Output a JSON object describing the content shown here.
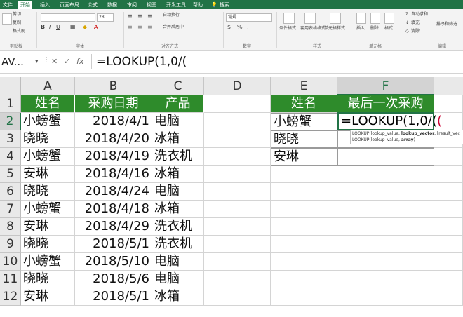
{
  "ribbon_tabs": [
    {
      "label": "文件",
      "active": false
    },
    {
      "label": "开始",
      "active": true
    },
    {
      "label": "插入",
      "active": false
    },
    {
      "label": "页面布局",
      "active": false
    },
    {
      "label": "公式",
      "active": false
    },
    {
      "label": "数据",
      "active": false
    },
    {
      "label": "审阅",
      "active": false
    },
    {
      "label": "视图",
      "active": false
    },
    {
      "label": "开发工具",
      "active": false
    },
    {
      "label": "帮助",
      "active": false
    }
  ],
  "tell_me_label": "搜索",
  "ribbon": {
    "cut": "剪切",
    "copy": "复制",
    "format_painter": "格式刷",
    "clipboard_group": "剪贴板",
    "font_name": "",
    "font_size": "28",
    "font_group": "字体",
    "wrap_text": "自动换行",
    "merge_center": "合并后居中",
    "alignment_group": "对齐方式",
    "number_format": "常规",
    "number_group": "数字",
    "conditional_format": "条件格式",
    "format_table": "套用表格格式",
    "cell_styles": "单元格样式",
    "styles_group": "样式",
    "insert": "插入",
    "delete": "删除",
    "format": "格式",
    "cells_group": "单元格",
    "autosum": "自动求和",
    "fill": "填充",
    "clear": "清除",
    "sort_filter": "排序和筛选",
    "editing_group": "编辑"
  },
  "formula_bar": {
    "name_box": "AV...",
    "cancel": "✕",
    "enter": "✓",
    "fx": "fx",
    "formula": "=LOOKUP(1,0/("
  },
  "columns": [
    "A",
    "B",
    "C",
    "D",
    "E",
    "F"
  ],
  "rows": [
    "1",
    "2",
    "3",
    "4",
    "5",
    "6",
    "7",
    "8",
    "9",
    "10",
    "11",
    "12"
  ],
  "left_table": {
    "headers": [
      "姓名",
      "采购日期",
      "产品"
    ],
    "rows": [
      [
        "小螃蟹",
        "2018/4/1",
        "电脑"
      ],
      [
        "晓晓",
        "2018/4/20",
        "冰箱"
      ],
      [
        "小螃蟹",
        "2018/4/19",
        "洗衣机"
      ],
      [
        "安琳",
        "2018/4/16",
        "冰箱"
      ],
      [
        "晓晓",
        "2018/4/24",
        "电脑"
      ],
      [
        "小螃蟹",
        "2018/4/18",
        "冰箱"
      ],
      [
        "安琳",
        "2018/4/29",
        "洗衣机"
      ],
      [
        "晓晓",
        "2018/5/1",
        "洗衣机"
      ],
      [
        "小螃蟹",
        "2018/5/10",
        "电脑"
      ],
      [
        "晓晓",
        "2018/5/6",
        "电脑"
      ],
      [
        "安琳",
        "2018/5/1",
        "冰箱"
      ]
    ]
  },
  "right_table": {
    "headers": [
      "姓名",
      "最后一次采购"
    ],
    "names": [
      "小螃蟹",
      "晓晓",
      "安琳"
    ],
    "editing_cell": "F2",
    "editing_text": "=LOOKUP(1,0/("
  },
  "tooltip": {
    "line1_prefix": "LOOKUP(lookup_value, ",
    "line1_bold": "lookup_vector",
    "line1_suffix": ", [result_vec",
    "line2_prefix": "LOOKUP(lookup_value, ",
    "line2_bold": "array",
    "line2_suffix": ")"
  },
  "colors": {
    "accent": "#217346",
    "header_fill": "#2e8b2b"
  }
}
